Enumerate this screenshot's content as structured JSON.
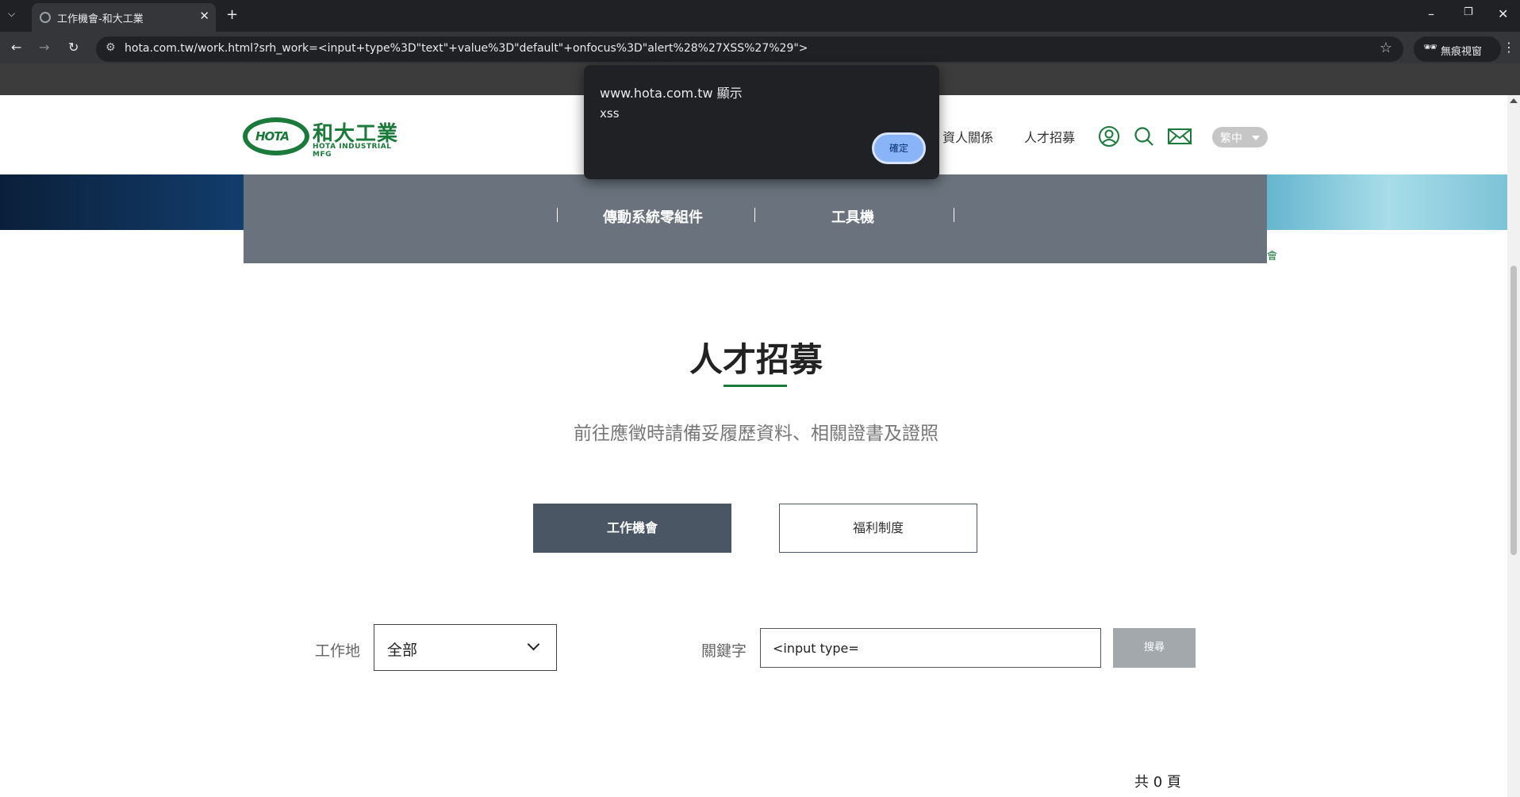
{
  "browser": {
    "tab_title": "工作機會-和大工業",
    "url": "hota.com.tw/work.html?srh_work=<input+type%3D\"text\"+value%3D\"default\"+onfocus%3D\"alert%28%27XSS%27%29\">",
    "profile_label": "無痕視窗"
  },
  "alert": {
    "origin": "www.hota.com.tw 顯示",
    "message": "xss",
    "ok_label": "確定"
  },
  "header": {
    "logo_mark": "HOTA",
    "logo_cn": "和大工業",
    "logo_en": "HOTA INDUSTRIAL MFG",
    "nav": [
      "資人關係",
      "人才招募"
    ],
    "lang": "繁中"
  },
  "submenu": [
    "傳動系統零組件",
    "工具機"
  ],
  "banner_stub": "會",
  "page": {
    "title": "人才招募",
    "subtitle": "前往應徵時請備妥履歷資料、相關證書及證照",
    "tabs": [
      "工作機會",
      "福利制度"
    ]
  },
  "filters": {
    "location_label": "工作地",
    "location_value": "全部",
    "keyword_label": "關鍵字",
    "keyword_value": "<input type=",
    "search_label": "搜尋"
  },
  "pagination": {
    "total_pages": "共 0 頁"
  },
  "colors": {
    "brand_green": "#1a7a3a",
    "submenu_gray": "#6a737d",
    "active_tab": "#4a5663"
  }
}
